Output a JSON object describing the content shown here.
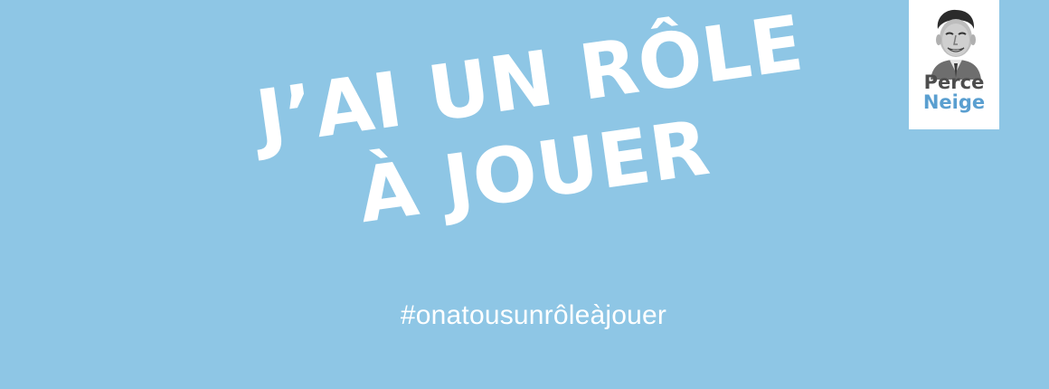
{
  "background_color": "#8ec6e5",
  "headline": {
    "line1": "J’AI UN RÔLE",
    "line2": "À JOUER",
    "color": "#ffffff"
  },
  "hashtag": "#onatousunrôleàjouer",
  "logo": {
    "word1": "Perce",
    "word2": "Neige",
    "word1_color": "#4d4d4d",
    "word2_color": "#5a9fd0",
    "portrait_icon": "man-portrait-icon"
  }
}
